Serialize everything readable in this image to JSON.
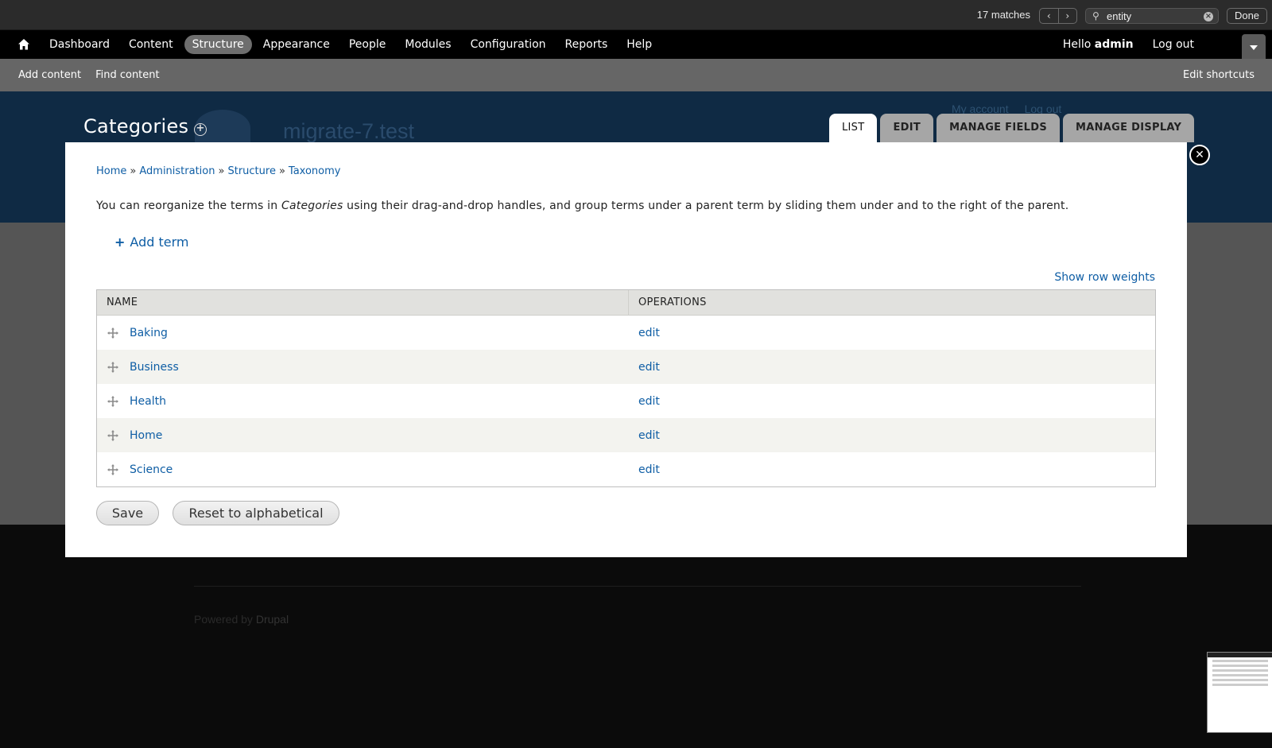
{
  "find_bar": {
    "match_count": "17 matches",
    "prev_icon": "chevron-left-icon",
    "next_icon": "chevron-right-icon",
    "search_value": "entity",
    "done_label": "Done"
  },
  "toolbar": {
    "home_icon": "home-icon",
    "menu": [
      {
        "label": "Dashboard"
      },
      {
        "label": "Content"
      },
      {
        "label": "Structure",
        "active": true
      },
      {
        "label": "Appearance"
      },
      {
        "label": "People"
      },
      {
        "label": "Modules"
      },
      {
        "label": "Configuration"
      },
      {
        "label": "Reports"
      },
      {
        "label": "Help"
      }
    ],
    "hello_prefix": "Hello ",
    "username": "admin",
    "logout_label": "Log out"
  },
  "shortcuts": {
    "items": [
      {
        "label": "Add content"
      },
      {
        "label": "Find content"
      }
    ],
    "edit_label": "Edit shortcuts"
  },
  "background": {
    "site_name": "migrate-7.test",
    "my_account": "My account",
    "log_out": "Log out",
    "powered_prefix": "Powered by ",
    "powered_link": "Drupal"
  },
  "overlay": {
    "title": "Categories",
    "tabs": [
      {
        "label": "LIST",
        "active": true
      },
      {
        "label": "EDIT"
      },
      {
        "label": "MANAGE FIELDS"
      },
      {
        "label": "MANAGE DISPLAY"
      }
    ]
  },
  "dialog": {
    "breadcrumb": [
      "Home",
      "Administration",
      "Structure",
      "Taxonomy"
    ],
    "breadcrumb_sep": "»",
    "help_prefix": "You can reorganize the terms in ",
    "help_vocab": "Categories",
    "help_suffix": " using their drag-and-drop handles, and group terms under a parent term by sliding them under and to the right of the parent.",
    "add_term_label": "Add term",
    "show_weights_label": "Show row weights",
    "table": {
      "headers": [
        "NAME",
        "OPERATIONS"
      ],
      "rows": [
        {
          "name": "Baking",
          "op": "edit"
        },
        {
          "name": "Business",
          "op": "edit"
        },
        {
          "name": "Health",
          "op": "edit"
        },
        {
          "name": "Home",
          "op": "edit"
        },
        {
          "name": "Science",
          "op": "edit"
        }
      ]
    },
    "save_label": "Save",
    "reset_label": "Reset to alphabetical"
  },
  "colors": {
    "link": "#0f5ea5",
    "toolbar_bg": "#000000",
    "shortcuts_bg": "#666666",
    "header_bg": "#0f2a44"
  }
}
